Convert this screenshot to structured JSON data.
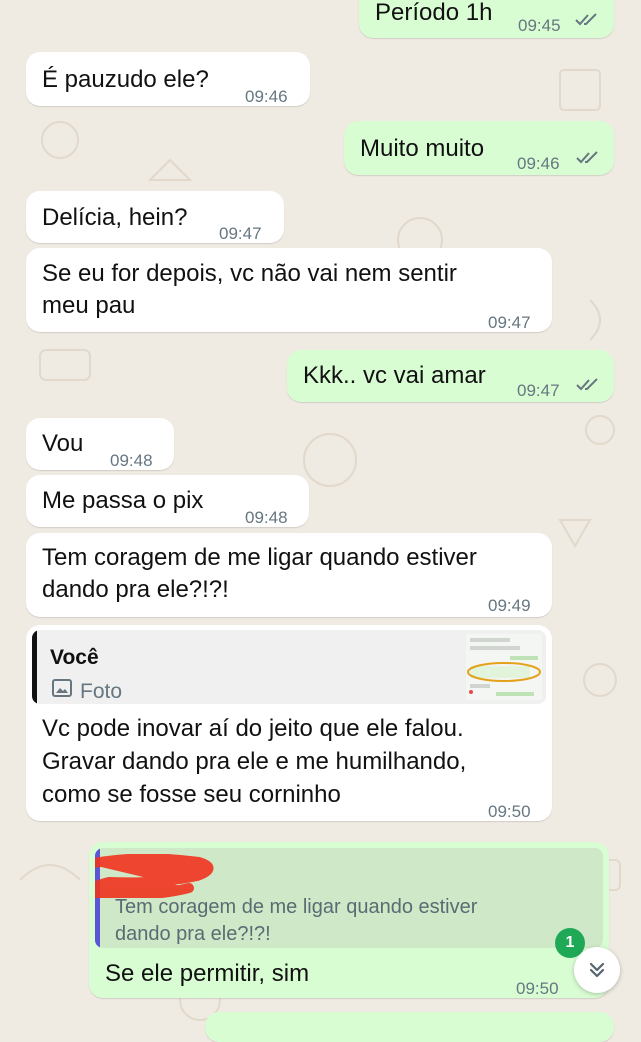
{
  "chat": {
    "messages": [
      {
        "direction": "outgoing",
        "text": "Período 1h",
        "time": "09:45",
        "status": "read"
      },
      {
        "direction": "incoming",
        "text": "É pauzudo ele?",
        "time": "09:46"
      },
      {
        "direction": "outgoing",
        "text": "Muito muito",
        "time": "09:46",
        "status": "read"
      },
      {
        "direction": "incoming",
        "text": "Delícia, hein?",
        "time": "09:47"
      },
      {
        "direction": "incoming",
        "line1": "Se eu for depois, vc não vai nem sentir",
        "line2": "meu pau",
        "time": "09:47"
      },
      {
        "direction": "outgoing",
        "text": "Kkk.. vc vai amar",
        "time": "09:47",
        "status": "read"
      },
      {
        "direction": "incoming",
        "text": "Vou",
        "time": "09:48"
      },
      {
        "direction": "incoming",
        "text": "Me passa o pix",
        "time": "09:48"
      },
      {
        "direction": "incoming",
        "line1": "Tem coragem de me ligar quando estiver",
        "line2": "dando pra ele?!?!",
        "time": "09:49"
      },
      {
        "direction": "incoming",
        "reply": {
          "author": "Você",
          "type": "Foto"
        },
        "line1": "Vc pode inovar aí do jeito que ele falou.",
        "line2": "Gravar dando pra ele e me humilhando,",
        "line3": "como se fosse seu corninho",
        "time": "09:50"
      },
      {
        "direction": "outgoing",
        "reply": {
          "line1": "Tem coragem de me ligar quando estiver",
          "line2": "dando pra ele?!?!"
        },
        "text": "Se ele permitir, sim",
        "time": "09:50"
      }
    ],
    "unread_count": "1"
  },
  "colors": {
    "incoming_bubble": "#ffffff",
    "outgoing_bubble": "#d9fdd3",
    "read_ticks": "#53bdeb",
    "time_text": "#667781",
    "wallpaper": "#efeae2",
    "quote_bar_incoming": "#111111",
    "quote_bar_outgoing": "#5b56d6",
    "badge": "#1fa855",
    "redaction": "#f0341e"
  },
  "icons": [
    "double-check-icon",
    "image-icon",
    "chevron-double-down-icon"
  ]
}
